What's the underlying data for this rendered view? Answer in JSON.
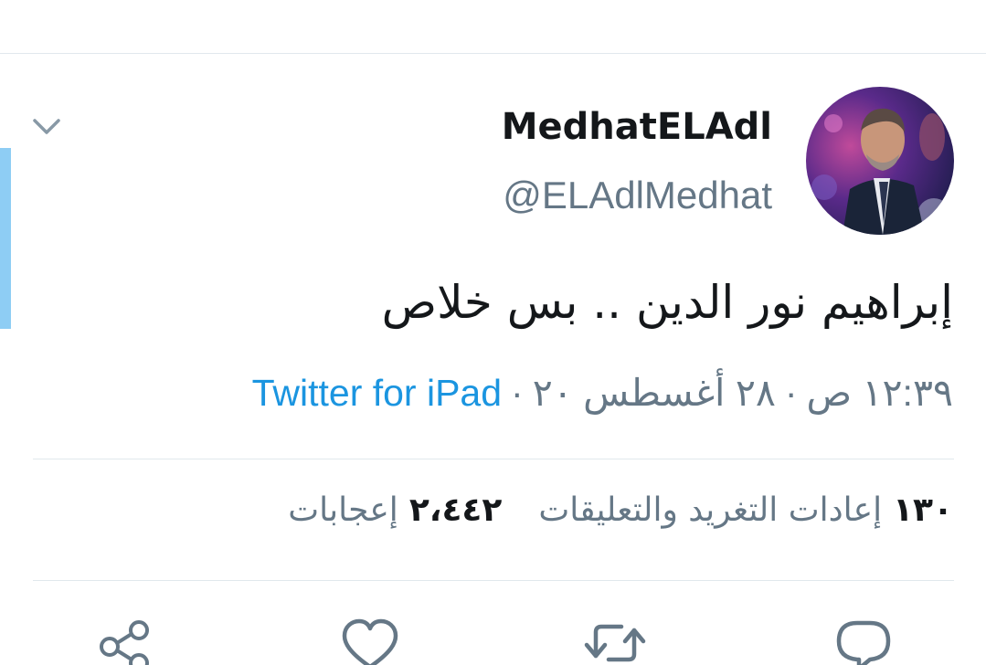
{
  "tweet": {
    "author": {
      "display_name": "MedhatELAdl",
      "handle": "@ELAdlMedhat"
    },
    "text": "إبراهيم نور الدين .. بس خلاص",
    "time": "١٢:٣٩ ص",
    "date": "٢٨ أغسطس ٢٠",
    "separator": "·",
    "source": "Twitter for iPad",
    "stats": {
      "retweets_count": "١٣٠",
      "retweets_label": "إعادات التغريد والتعليقات",
      "likes_count": "٢،٤٤٢",
      "likes_label": "إعجابات"
    }
  },
  "icons": {
    "menu": "chevron-down-icon",
    "share": "share-icon",
    "like": "heart-icon",
    "retweet": "retweet-icon",
    "reply": "reply-icon"
  },
  "colors": {
    "text_primary": "#14171a",
    "text_secondary": "#657786",
    "link": "#1b95e0",
    "accent_bar": "#8ecdf4",
    "divider": "#e1e8ed"
  }
}
